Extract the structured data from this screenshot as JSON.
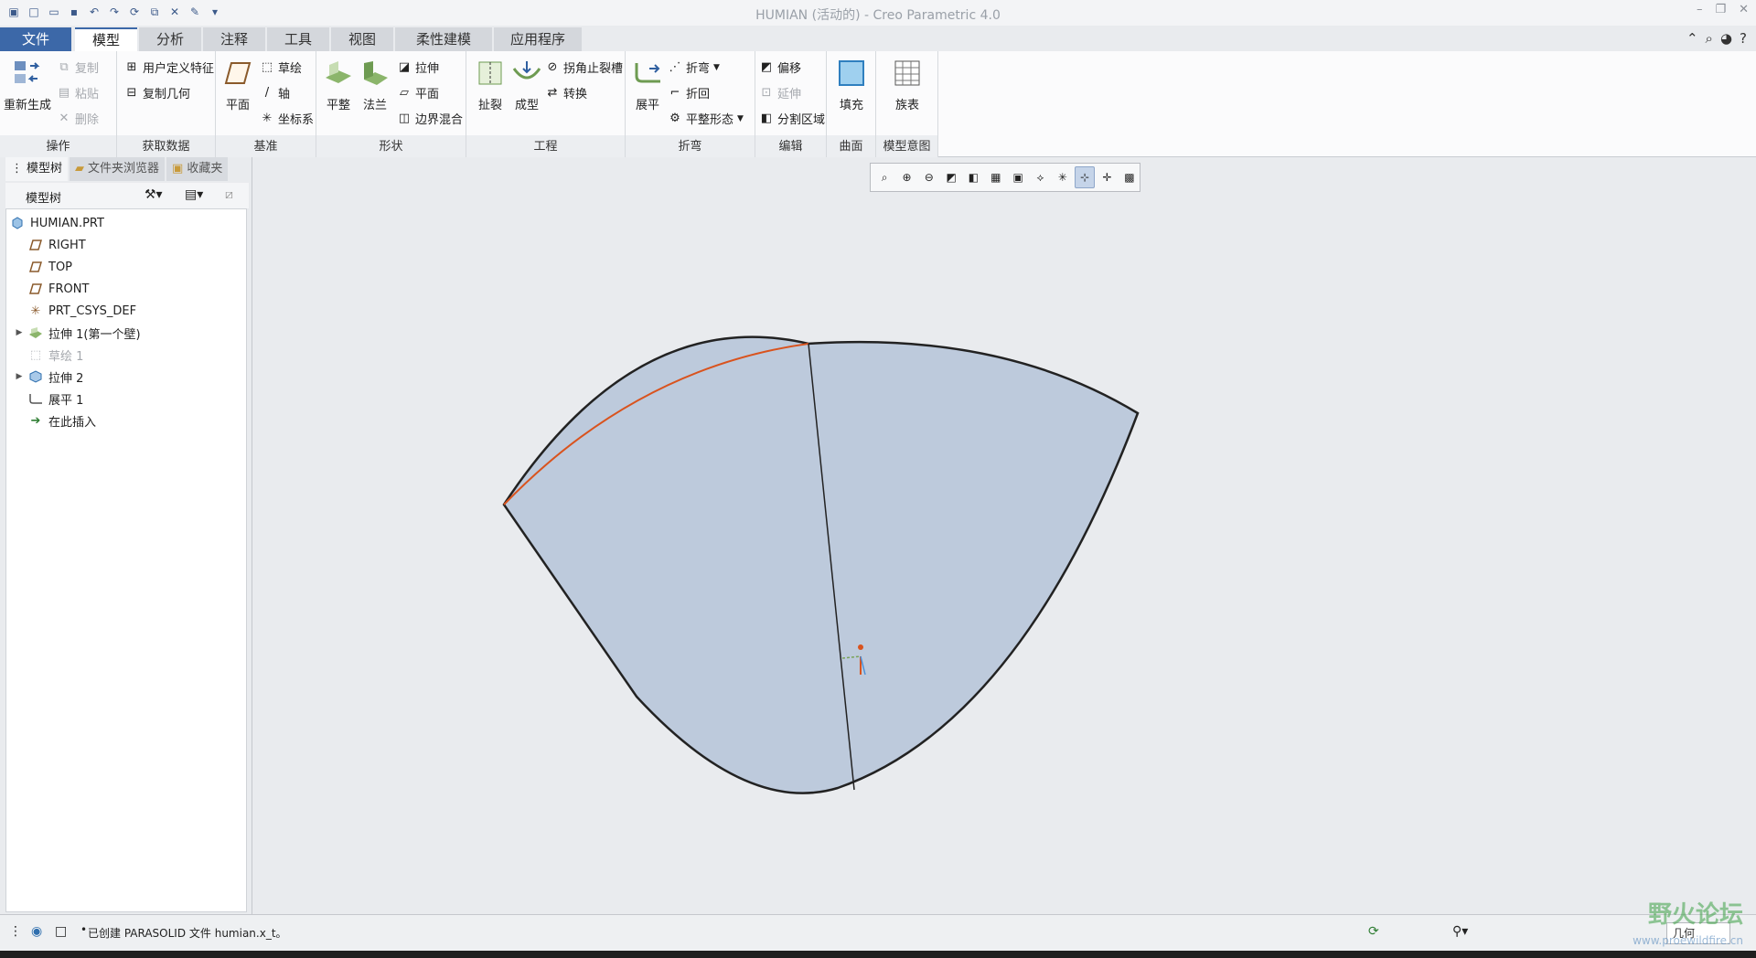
{
  "window": {
    "title": "HUMIAN (活动的) - Creo Parametric 4.0"
  },
  "tabs": [
    {
      "label": "文件"
    },
    {
      "label": "模型"
    },
    {
      "label": "分析"
    },
    {
      "label": "注释"
    },
    {
      "label": "工具"
    },
    {
      "label": "视图"
    },
    {
      "label": "柔性建模"
    },
    {
      "label": "应用程序"
    }
  ],
  "ribbon": {
    "operations": {
      "regen": "重新生成",
      "copy": "复制",
      "paste": "粘贴",
      "delete": "删除",
      "label": "操作"
    },
    "getdata": {
      "udf": "用户定义特征",
      "copygeom": "复制几何",
      "label": "获取数据"
    },
    "datum": {
      "plane": "平面",
      "sketch": "草绘",
      "axis": "轴",
      "csys": "坐标系",
      "label": "基准"
    },
    "shape": {
      "flat": "平整",
      "flange": "法兰",
      "extrude": "拉伸",
      "planar": "平面",
      "blend": "边界混合",
      "label": "形状"
    },
    "engineering": {
      "rip": "扯裂",
      "form": "成型",
      "cornerrelief": "拐角止裂槽",
      "convert": "转换",
      "label": "工程"
    },
    "bends": {
      "unbend": "展平",
      "bend": "折弯",
      "bendback": "折回",
      "flatform": "平整形态",
      "label": "折弯"
    },
    "editing": {
      "offset": "偏移",
      "extend": "延伸",
      "split": "分割区域",
      "label": "编辑"
    },
    "surfaces": {
      "fill": "填充",
      "label": "曲面"
    },
    "intent": {
      "family": "族表",
      "label": "模型意图"
    }
  },
  "panel": {
    "tabs": [
      "模型树",
      "文件夹浏览器",
      "收藏夹"
    ],
    "tree_title": "模型树",
    "items": [
      {
        "label": "HUMIAN.PRT",
        "icon": "part-icon",
        "dim": false,
        "expand": ""
      },
      {
        "label": "RIGHT",
        "icon": "datum-plane-icon",
        "dim": false,
        "expand": ""
      },
      {
        "label": "TOP",
        "icon": "datum-plane-icon",
        "dim": false,
        "expand": ""
      },
      {
        "label": "FRONT",
        "icon": "datum-plane-icon",
        "dim": false,
        "expand": ""
      },
      {
        "label": "PRT_CSYS_DEF",
        "icon": "csys-icon",
        "dim": false,
        "expand": ""
      },
      {
        "label": "拉伸 1(第一个壁)",
        "icon": "extrude-wall-icon",
        "dim": false,
        "expand": "▶"
      },
      {
        "label": "草绘 1",
        "icon": "sketch-icon",
        "dim": true,
        "expand": ""
      },
      {
        "label": "拉伸 2",
        "icon": "extrude-icon",
        "dim": false,
        "expand": "▶"
      },
      {
        "label": "展平 1",
        "icon": "unbend-icon",
        "dim": false,
        "expand": ""
      },
      {
        "label": "在此插入",
        "icon": "insert-here-icon",
        "dim": false,
        "expand": ""
      }
    ]
  },
  "status": {
    "message": "已创建 PARASOLID 文件 humian.x_t。",
    "filter": "几何"
  },
  "watermark": {
    "text": "野火论坛",
    "url": "www.proewildfire.cn"
  },
  "colors": {
    "file_tab": "#3c68a8",
    "part_fill": "#bdcadc",
    "highlight_edge": "#d9531e"
  }
}
